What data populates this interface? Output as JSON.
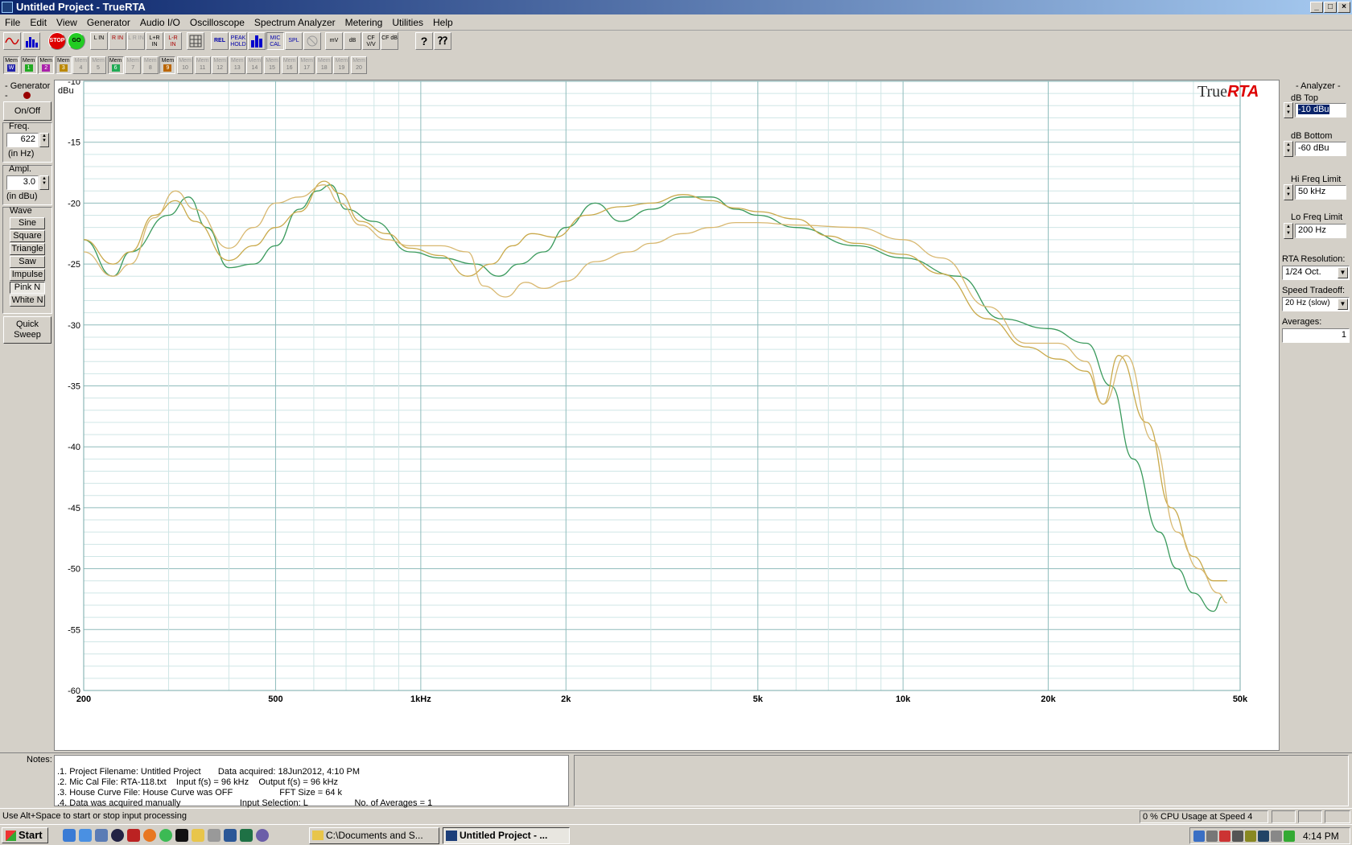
{
  "window": {
    "title": "Untitled Project - TrueRTA",
    "min": "_",
    "max": "□",
    "close": "×"
  },
  "menu": [
    "File",
    "Edit",
    "View",
    "Generator",
    "Audio I/O",
    "Oscilloscope",
    "Spectrum Analyzer",
    "Metering",
    "Utilities",
    "Help"
  ],
  "toolbar": {
    "stop": "STOP",
    "go": "GO",
    "l_in": "L IN",
    "r_in": "R IN",
    "lr_in_dim": "L R IN",
    "lpr_in": "L+R IN",
    "lmr_in": "L-R IN",
    "rel": "REL",
    "peak_hold": "PEAK HOLD",
    "mic_cal": "MIC CAL",
    "spl": "SPL",
    "mv": "mV",
    "db": "dB",
    "cf_vv": "CF V/V",
    "cf_db": "CF dB"
  },
  "memories": {
    "label": "Mem",
    "slots": [
      "W",
      "1",
      "2",
      "3",
      "4",
      "5",
      "6",
      "7",
      "8",
      "9",
      "10",
      "11",
      "12",
      "13",
      "14",
      "15",
      "16",
      "17",
      "18",
      "19",
      "20"
    ],
    "active": [
      true,
      true,
      true,
      true,
      false,
      false,
      true,
      false,
      false,
      true,
      false,
      false,
      false,
      false,
      false,
      false,
      false,
      false,
      false,
      false,
      false
    ]
  },
  "generator": {
    "title": "- Generator -",
    "onoff": "On/Off",
    "freq_label": "Freq.",
    "freq_value": "622",
    "freq_unit": "(in Hz)",
    "ampl_label": "Ampl.",
    "ampl_value": "3.0",
    "ampl_unit": "(in dBu)",
    "wave_label": "Wave",
    "waves": [
      "Sine",
      "Square",
      "Triangle",
      "Saw",
      "Impulse",
      "Pink N",
      "White N"
    ],
    "selected_wave": "Pink N",
    "quick_sweep": "Quick Sweep"
  },
  "analyzer": {
    "title": "- Analyzer -",
    "db_top_label": "dB Top",
    "db_top_value": "-10 dBu",
    "db_bottom_label": "dB Bottom",
    "db_bottom_value": "-60 dBu",
    "hi_freq_label": "Hi Freq Limit",
    "hi_freq_value": "50 kHz",
    "lo_freq_label": "Lo Freq Limit",
    "lo_freq_value": "200 Hz",
    "resolution_label": "RTA Resolution:",
    "resolution_value": "1/24 Oct.",
    "speed_label": "Speed Tradeoff:",
    "speed_value": "20 Hz (slow)",
    "averages_label": "Averages:",
    "averages_value": "1"
  },
  "chart_data": {
    "type": "line",
    "logo": {
      "prefix": "True",
      "suffix": "RTA"
    },
    "ylabel": "dBu",
    "ylim": [
      -60,
      -10
    ],
    "xlim": [
      200,
      50000
    ],
    "xscale": "log",
    "yticks": [
      -10,
      -15,
      -20,
      -25,
      -30,
      -35,
      -40,
      -45,
      -50,
      -55,
      -60
    ],
    "ytick_labels": [
      "-10",
      "-15",
      "-20",
      "-25",
      "-30",
      "-35",
      "-40",
      "-45",
      "-50",
      "-55",
      "-60"
    ],
    "xticks": [
      200,
      500,
      1000,
      2000,
      5000,
      10000,
      20000,
      50000
    ],
    "xtick_labels": [
      "200",
      "500",
      "1kHz",
      "2k",
      "5k",
      "10k",
      "20k",
      "50k"
    ],
    "grid": true,
    "series": [
      {
        "color": "#3a9a5c",
        "x": [
          200,
          230,
          250,
          300,
          330,
          360,
          400,
          450,
          500,
          560,
          610,
          650,
          700,
          800,
          950,
          1100,
          1300,
          1450,
          1600,
          1800,
          2000,
          2300,
          2600,
          3000,
          3500,
          4000,
          4500,
          5000,
          6000,
          8000,
          10000,
          13000,
          16000,
          20000,
          24000,
          27000,
          30000,
          34000,
          37000,
          40000,
          44000,
          46000
        ],
        "y": [
          -23,
          -26,
          -24,
          -21,
          -19.5,
          -22,
          -25.3,
          -25,
          -23.5,
          -20.5,
          -19,
          -18.5,
          -20.5,
          -21.5,
          -24,
          -24.5,
          -25,
          -26,
          -25,
          -24,
          -22,
          -20,
          -21.5,
          -20.5,
          -19.5,
          -19.5,
          -20.5,
          -21,
          -22,
          -23.5,
          -24.5,
          -26,
          -29.5,
          -30.3,
          -31.5,
          -35,
          -41,
          -47,
          -50,
          -52,
          -53.5,
          -52.3
        ]
      },
      {
        "color": "#c9a94a",
        "x": [
          200,
          230,
          250,
          280,
          310,
          340,
          400,
          450,
          500,
          560,
          630,
          680,
          750,
          850,
          950,
          1100,
          1250,
          1400,
          1550,
          1700,
          1900,
          2200,
          2600,
          3000,
          3500,
          4000,
          4500,
          5000,
          6000,
          7000,
          8000,
          10000,
          12000,
          15000,
          18000,
          21000,
          24000,
          26000,
          28000,
          32000,
          36000,
          40000,
          44000,
          47000
        ],
        "y": [
          -23,
          -25,
          -24,
          -21,
          -19.8,
          -21.5,
          -24.7,
          -23.5,
          -22,
          -20.7,
          -18.2,
          -19.2,
          -21.5,
          -22.5,
          -23.7,
          -24.3,
          -26,
          -25,
          -23.5,
          -22.5,
          -22.8,
          -21,
          -20.3,
          -20,
          -19.3,
          -19.8,
          -20.4,
          -20.7,
          -21.3,
          -22.7,
          -23.3,
          -24.2,
          -25.8,
          -29.5,
          -31.8,
          -32.8,
          -33.8,
          -36.5,
          -32.5,
          -38,
          -45,
          -49,
          -51,
          -51
        ]
      },
      {
        "color": "#d8b870",
        "x": [
          200,
          230,
          250,
          280,
          310,
          340,
          400,
          450,
          500,
          560,
          630,
          680,
          750,
          850,
          950,
          1100,
          1250,
          1350,
          1500,
          1650,
          1800,
          2000,
          2300,
          2700,
          3000,
          3500,
          4000,
          4500,
          5000,
          6000,
          8000,
          10000,
          12000,
          15000,
          18000,
          21000,
          24000,
          26000,
          29000,
          33000,
          37000,
          41000,
          45000,
          47000
        ],
        "y": [
          -24,
          -26,
          -25,
          -21.2,
          -19,
          -20.5,
          -23.7,
          -22,
          -20,
          -19.5,
          -18.5,
          -20,
          -21.8,
          -23,
          -23.5,
          -23.5,
          -24,
          -26.8,
          -27.7,
          -26.5,
          -27,
          -26.4,
          -24.8,
          -24,
          -23.3,
          -22.5,
          -22,
          -21.6,
          -21.6,
          -21.8,
          -22,
          -23,
          -24.5,
          -28.5,
          -31.5,
          -31.5,
          -33,
          -36.5,
          -32.5,
          -39.5,
          -47,
          -50,
          -52,
          -52.8
        ]
      }
    ]
  },
  "notes": {
    "label": "Notes:",
    "lines": [
      ".1. Project Filename: Untitled Project       Data acquired: 18Jun2012, 4:10 PM",
      ".2. Mic Cal File: RTA-118.txt    Input f(s) = 96 kHz    Output f(s) = 96 kHz",
      ".3. House Curve File: House Curve was OFF                   FFT Size = 64 k",
      ".4. Data was acquired manually                        Input Selection: L                   No. of Averages = 1"
    ]
  },
  "status": {
    "hint": "Use Alt+Space to start or stop input processing",
    "cpu": "0 % CPU Usage at Speed 4"
  },
  "taskbar": {
    "start": "Start",
    "tasks": [
      "C:\\Documents and S...",
      "Untitled Project - ..."
    ],
    "clock": "4:14 PM"
  }
}
